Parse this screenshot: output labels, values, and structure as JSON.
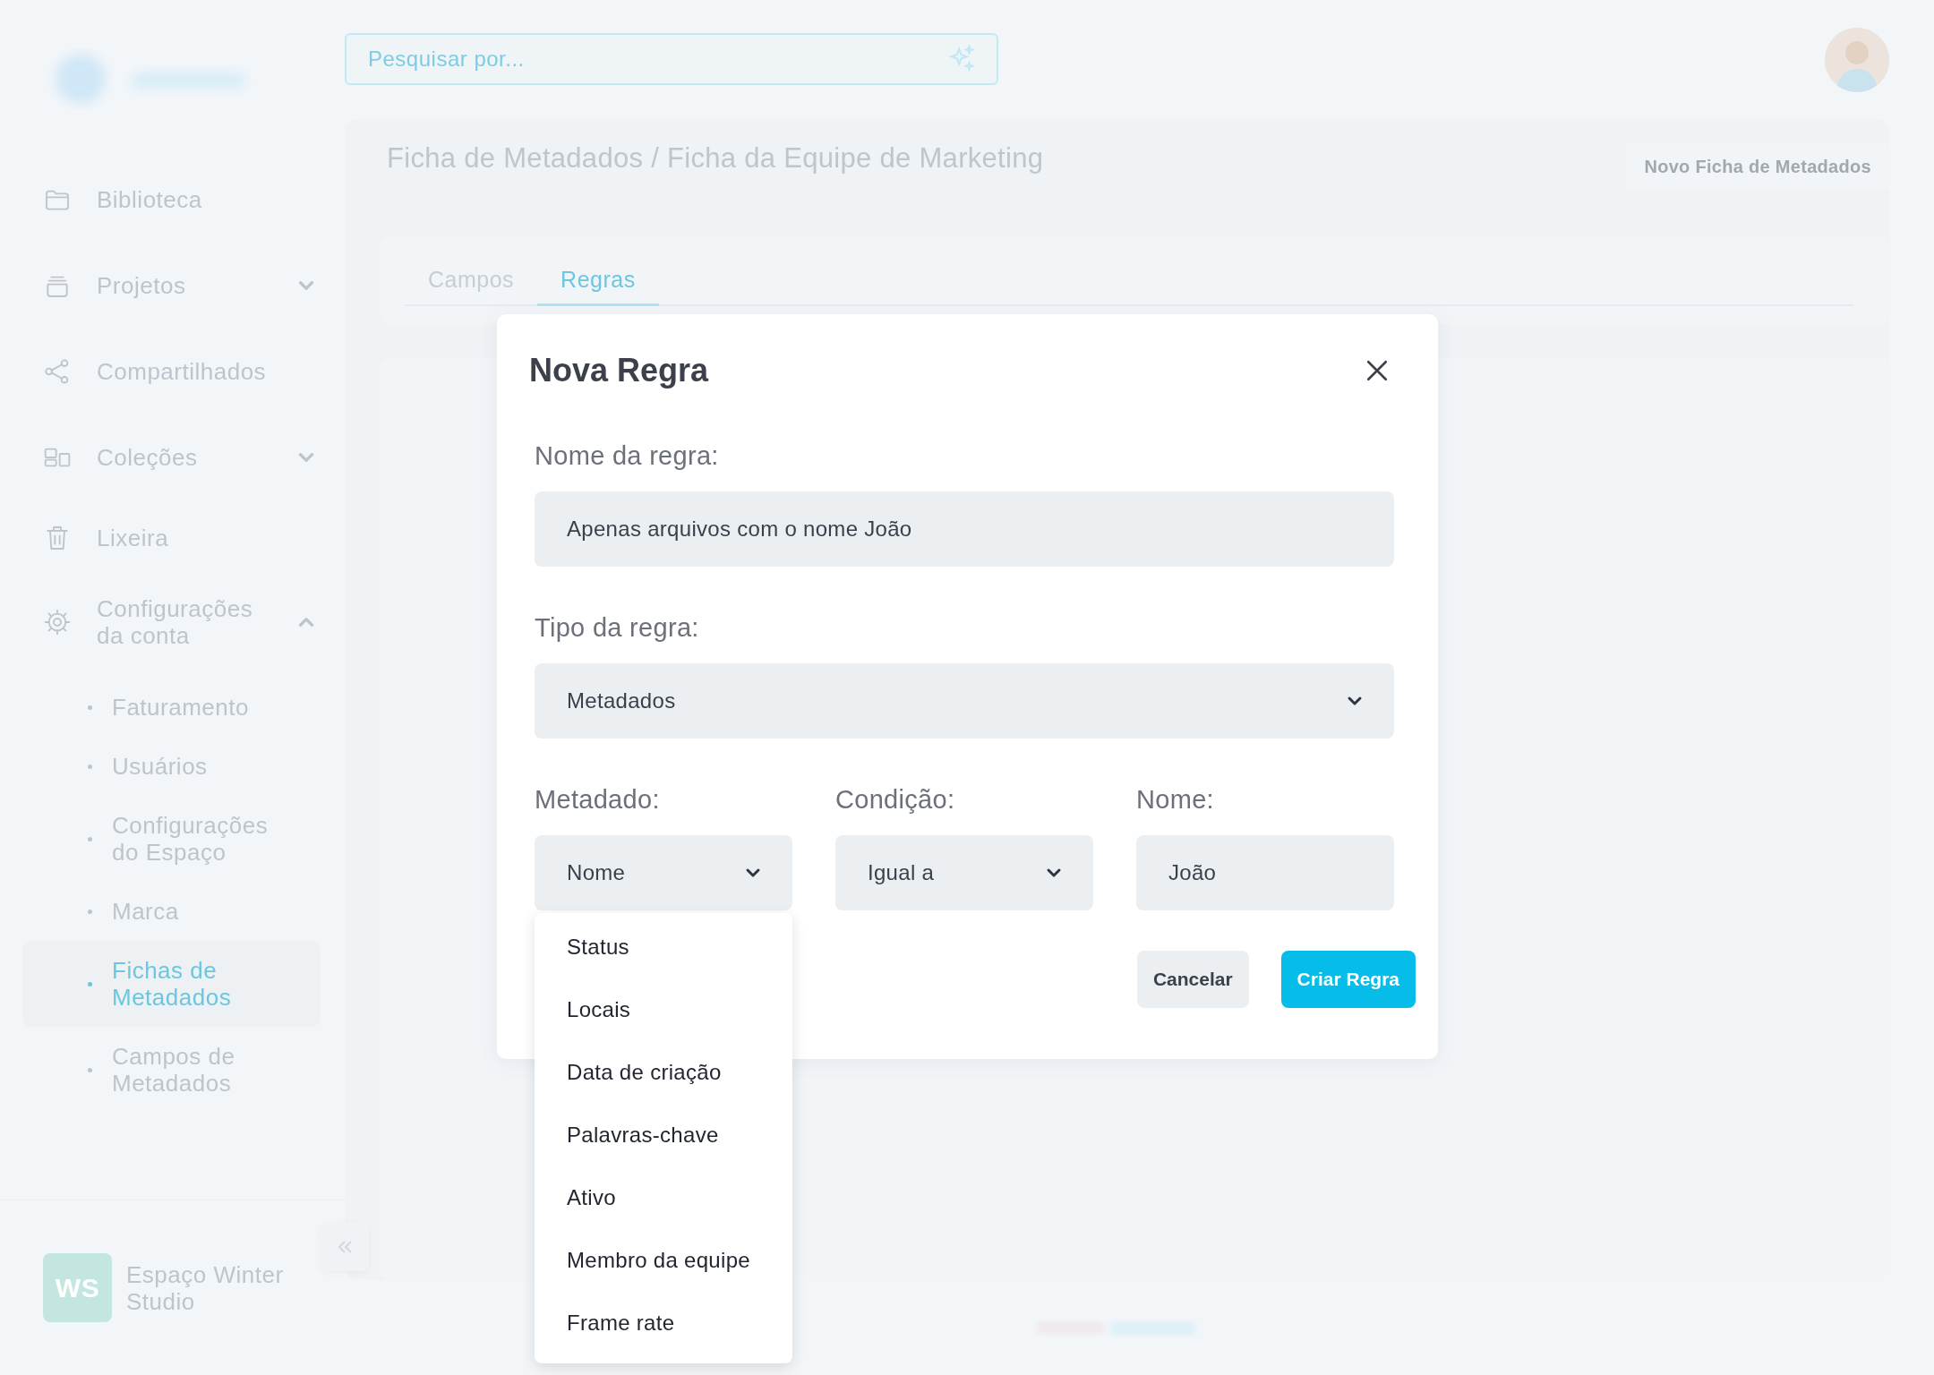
{
  "header": {
    "search": {
      "placeholder": "Pesquisar por..."
    }
  },
  "sidebar": {
    "items": [
      {
        "label": "Biblioteca"
      },
      {
        "label": "Projetos",
        "expanded": false
      },
      {
        "label": "Compartilhados"
      },
      {
        "label": "Coleções",
        "expanded": false
      },
      {
        "label": "Lixeira"
      },
      {
        "label": "Configurações da conta",
        "expanded": true,
        "children": [
          {
            "label": "Faturamento",
            "selected": false
          },
          {
            "label": "Usuários",
            "selected": false
          },
          {
            "label": "Configurações do Espaço",
            "selected": false
          },
          {
            "label": "Marca",
            "selected": false
          },
          {
            "label": "Fichas de Metadados",
            "selected": true
          },
          {
            "label": "Campos de Metadados",
            "selected": false
          }
        ]
      }
    ],
    "workspace": {
      "initials": "WS",
      "name": "Espaço Winter Studio"
    }
  },
  "page": {
    "breadcrumb": "Ficha de Metadados / Ficha da Equipe de Marketing",
    "new_button": "Novo Ficha de Metadados",
    "tabs": [
      {
        "label": "Campos",
        "selected": false
      },
      {
        "label": "Regras",
        "selected": true
      }
    ]
  },
  "modal": {
    "title": "Nova Regra",
    "rule_name": {
      "label": "Nome da regra:",
      "value": "Apenas arquivos com o nome João"
    },
    "rule_type": {
      "label": "Tipo da regra:",
      "value": "Metadados"
    },
    "conditions": [
      {
        "kind": "select",
        "label": "Metadado:",
        "value": "Nome",
        "options": [
          "Status",
          "Locais",
          "Data de criação",
          "Palavras-chave",
          "Ativo",
          "Membro da equipe",
          "Frame rate"
        ]
      },
      {
        "kind": "select",
        "label": "Condição:",
        "value": "Igual a"
      },
      {
        "kind": "input",
        "label": "Nome:",
        "value": "João"
      }
    ],
    "buttons": [
      {
        "label": "Cancelar",
        "kind": "secondary"
      },
      {
        "label": "Criar Regra",
        "kind": "primary"
      }
    ]
  }
}
